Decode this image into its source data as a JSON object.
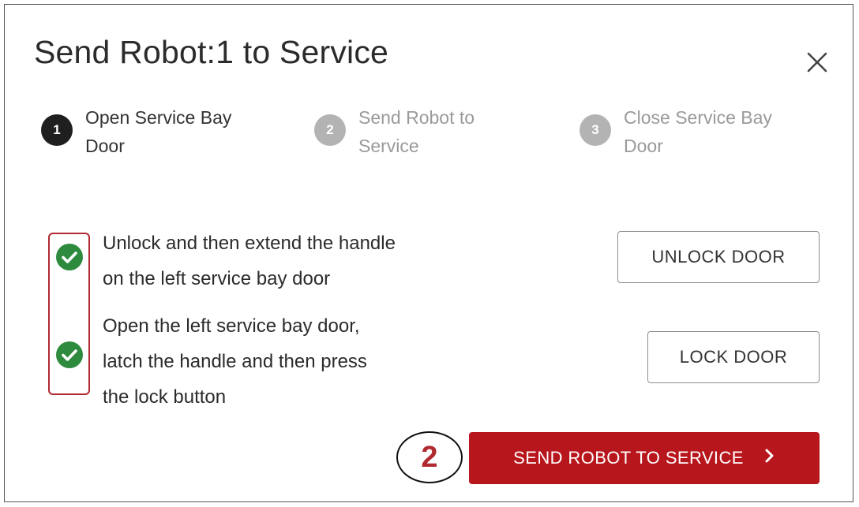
{
  "dialog": {
    "title": "Send Robot:1 to Service",
    "close_icon": "close-icon"
  },
  "steps": [
    {
      "number": "1",
      "label": "Open Service Bay Door",
      "state": "active"
    },
    {
      "number": "2",
      "label": "Send Robot to Service",
      "state": "inactive"
    },
    {
      "number": "3",
      "label": "Close Service Bay Door",
      "state": "inactive"
    }
  ],
  "tasks": [
    {
      "lines": [
        "Unlock and then extend the handle",
        "on the left service bay door"
      ],
      "status_icon": "check-circle-icon",
      "button_label": "UNLOCK DOOR"
    },
    {
      "lines": [
        "Open the left service bay door,",
        "latch the handle and then press",
        "the lock button"
      ],
      "status_icon": "check-circle-icon",
      "button_label": "LOCK DOOR"
    }
  ],
  "footer": {
    "primary_label": "SEND ROBOT TO SERVICE",
    "primary_icon": "chevron-right-icon",
    "annotation_number": "2"
  },
  "colors": {
    "primary": "#b8161d",
    "check": "#2e8b3e",
    "step_active": "#1f1f1f",
    "step_inactive": "#b3b3b3",
    "annotation": "#b02a30"
  }
}
